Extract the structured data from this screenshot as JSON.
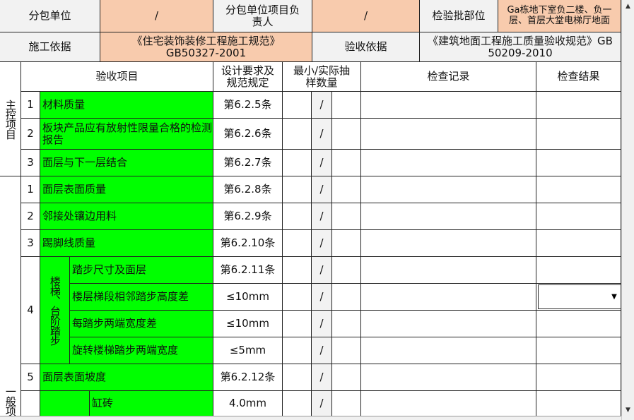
{
  "header": {
    "sub_unit_label": "分包单位",
    "sub_unit_value": "/",
    "sub_pm_label": "分包单位项目负责人",
    "sub_pm_value": "/",
    "lot_location_label": "检验批部位",
    "lot_location_value": "Ga栋地下室负二楼、负一层、首层大堂电梯厅地面",
    "basis_label": "施工依据",
    "basis_value": "《住宅装饰装修工程施工规范》GB50327-2001",
    "accept_basis_label": "验收依据",
    "accept_basis_value": "《建筑地面工程施工质量验收规范》GB 50209-2010"
  },
  "columns": {
    "item": "验收项目",
    "spec": "设计要求及规范规定",
    "sample": "最小/实际抽样数量",
    "record": "检查记录",
    "result": "检查结果"
  },
  "sections": {
    "main": "主控项目",
    "general": "一般项"
  },
  "main_items": [
    {
      "no": "1",
      "name": "材料质量",
      "spec": "第6.2.5条",
      "sample": "/"
    },
    {
      "no": "2",
      "name": "板块产品应有放射性限量合格的检测报告",
      "spec": "第6.2.6条",
      "sample": "/"
    },
    {
      "no": "3",
      "name": "面层与下一层结合",
      "spec": "第6.2.7条",
      "sample": "/"
    }
  ],
  "general_items": [
    {
      "no": "1",
      "name": "面层表面质量",
      "spec": "第6.2.8条",
      "sample": "/"
    },
    {
      "no": "2",
      "name": "邻接处镶边用料",
      "spec": "第6.2.9条",
      "sample": "/"
    },
    {
      "no": "3",
      "name": "踢脚线质量",
      "spec": "第6.2.10条",
      "sample": "/"
    }
  ],
  "stairs": {
    "no": "4",
    "group": "楼梯、台阶踏步",
    "rows": [
      {
        "name": "踏步尺寸及面层",
        "spec": "第6.2.11条",
        "sample": "/"
      },
      {
        "name": "楼层梯段相邻踏步高度差",
        "spec": "≤10mm",
        "sample": "/"
      },
      {
        "name": "每踏步两端宽度差",
        "spec": "≤10mm",
        "sample": "/"
      },
      {
        "name": "旋转楼梯踏步两端宽度",
        "spec": "≤5mm",
        "sample": "/"
      }
    ]
  },
  "slope": {
    "no": "5",
    "name": "面层表面坡度",
    "spec": "第6.2.12条",
    "sample": "/"
  },
  "tile": {
    "name": "缸砖",
    "spec": "4.0mm",
    "sample": "/"
  },
  "icons": {
    "dropdown": "chevron-down-icon",
    "scroll_up": "scroll-up-icon",
    "scroll_down": "scroll-down-icon"
  }
}
